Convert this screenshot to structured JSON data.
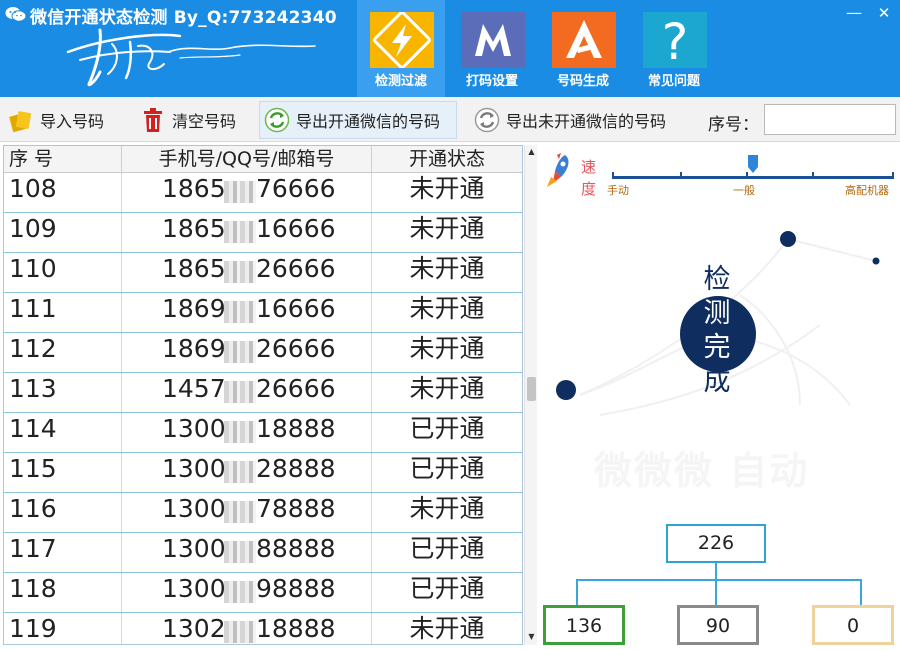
{
  "window": {
    "title": "微信开通状态检测 By_Q:773242340",
    "minimize_label": "—",
    "close_label": "✕"
  },
  "nav": {
    "tabs": [
      {
        "label": "检测过滤",
        "icon": "lightning-icon",
        "color": "#f7b500",
        "active": true
      },
      {
        "label": "打码设置",
        "icon": "letter-m-icon",
        "color": "#5b6db8",
        "active": false
      },
      {
        "label": "号码生成",
        "icon": "letter-a-icon",
        "color": "#f26b21",
        "active": false
      },
      {
        "label": "常见问题",
        "icon": "question-icon",
        "color": "#1ba7cf",
        "active": false
      }
    ]
  },
  "toolbar": {
    "import_label": "导入号码",
    "clear_label": "清空号码",
    "export_open_label": "导出开通微信的号码",
    "export_unopen_label": "导出未开通微信的号码",
    "serial_label": "序号：",
    "serial_value": "",
    "serial_placeholder": ""
  },
  "table": {
    "columns": [
      "序 号",
      "手机号/QQ号/邮箱号",
      "开通状态"
    ],
    "rows": [
      {
        "serial": "108",
        "prefix": "1865",
        "suffix": "76666",
        "status": "未开通"
      },
      {
        "serial": "109",
        "prefix": "1865",
        "suffix": "16666",
        "status": "未开通"
      },
      {
        "serial": "110",
        "prefix": "1865",
        "suffix": "26666",
        "status": "未开通"
      },
      {
        "serial": "111",
        "prefix": "1869",
        "suffix": "16666",
        "status": "未开通"
      },
      {
        "serial": "112",
        "prefix": "1869",
        "suffix": "26666",
        "status": "未开通"
      },
      {
        "serial": "113",
        "prefix": "1457",
        "suffix": "26666",
        "status": "未开通"
      },
      {
        "serial": "114",
        "prefix": "1300",
        "suffix": "18888",
        "status": "已开通"
      },
      {
        "serial": "115",
        "prefix": "1300",
        "suffix": "28888",
        "status": "已开通"
      },
      {
        "serial": "116",
        "prefix": "1300",
        "suffix": "78888",
        "status": "未开通"
      },
      {
        "serial": "117",
        "prefix": "1300",
        "suffix": "88888",
        "status": "已开通"
      },
      {
        "serial": "118",
        "prefix": "1300",
        "suffix": "98888",
        "status": "已开通"
      },
      {
        "serial": "119",
        "prefix": "1302",
        "suffix": "18888",
        "status": "未开通"
      }
    ]
  },
  "speed": {
    "label_top": "速",
    "label_bottom": "度",
    "marks": [
      "手动",
      "一般",
      "高配机器"
    ],
    "level": 0.5
  },
  "status_chars": [
    "检",
    "测",
    "完",
    "成"
  ],
  "watermark": "微微微 自动",
  "stats": {
    "total": "226",
    "opened": "136",
    "not_opened": "90",
    "other": "0"
  }
}
